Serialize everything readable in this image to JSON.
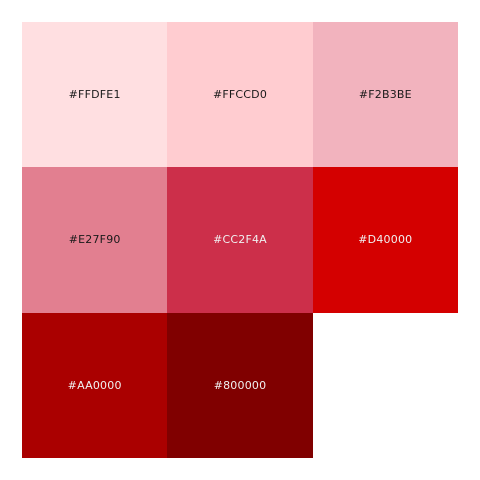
{
  "swatches": [
    {
      "label": "#FFDFE1",
      "color": "#FFDFE1",
      "text_color": "#1a1a1a"
    },
    {
      "label": "#FFCCD0",
      "color": "#FFCCD0",
      "text_color": "#1a1a1a"
    },
    {
      "label": "#F2B3BE",
      "color": "#F2B3BE",
      "text_color": "#1a1a1a"
    },
    {
      "label": "#E27F90",
      "color": "#E27F90",
      "text_color": "#1a1a1a"
    },
    {
      "label": "#CC2F4A",
      "color": "#CC2F4A",
      "text_color": "#f0f0f0"
    },
    {
      "label": "#D40000",
      "color": "#D40000",
      "text_color": "#f0f0f0"
    },
    {
      "label": "#AA0000",
      "color": "#AA0000",
      "text_color": "#f0f0f0"
    },
    {
      "label": "#800000",
      "color": "#800000",
      "text_color": "#f0f0f0"
    }
  ]
}
